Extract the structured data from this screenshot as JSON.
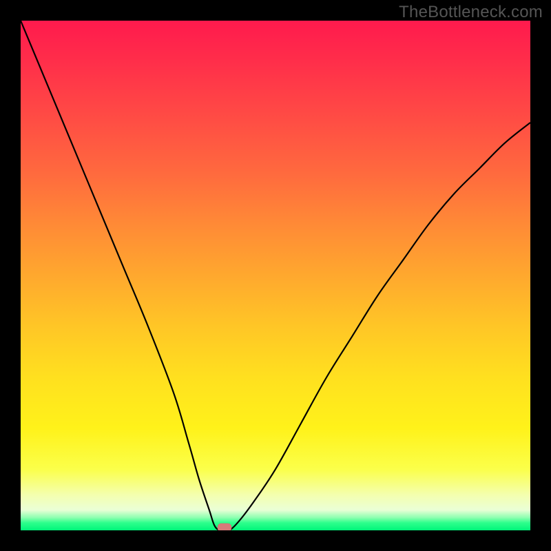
{
  "watermark": "TheBottleneck.com",
  "colors": {
    "frame": "#000000",
    "gradient_top": "#ff1a4d",
    "gradient_bottom": "#00f57a",
    "curve": "#000000",
    "marker": "#d87a7a"
  },
  "chart_data": {
    "type": "line",
    "title": "",
    "xlabel": "",
    "ylabel": "",
    "xlim": [
      0,
      100
    ],
    "ylim": [
      0,
      100
    ],
    "grid": false,
    "legend": false,
    "curve": {
      "name": "bottleneck-curve",
      "x": [
        0,
        5,
        10,
        15,
        20,
        25,
        30,
        33,
        35,
        37,
        38,
        39,
        40,
        41,
        43,
        46,
        50,
        55,
        60,
        65,
        70,
        75,
        80,
        85,
        90,
        95,
        100
      ],
      "y": [
        100,
        88,
        76,
        64,
        52,
        40,
        27,
        17,
        10,
        4,
        1,
        0,
        0,
        0,
        2,
        6,
        12,
        21,
        30,
        38,
        46,
        53,
        60,
        66,
        71,
        76,
        80
      ]
    },
    "minimum": {
      "x": 40,
      "y": 0
    }
  }
}
